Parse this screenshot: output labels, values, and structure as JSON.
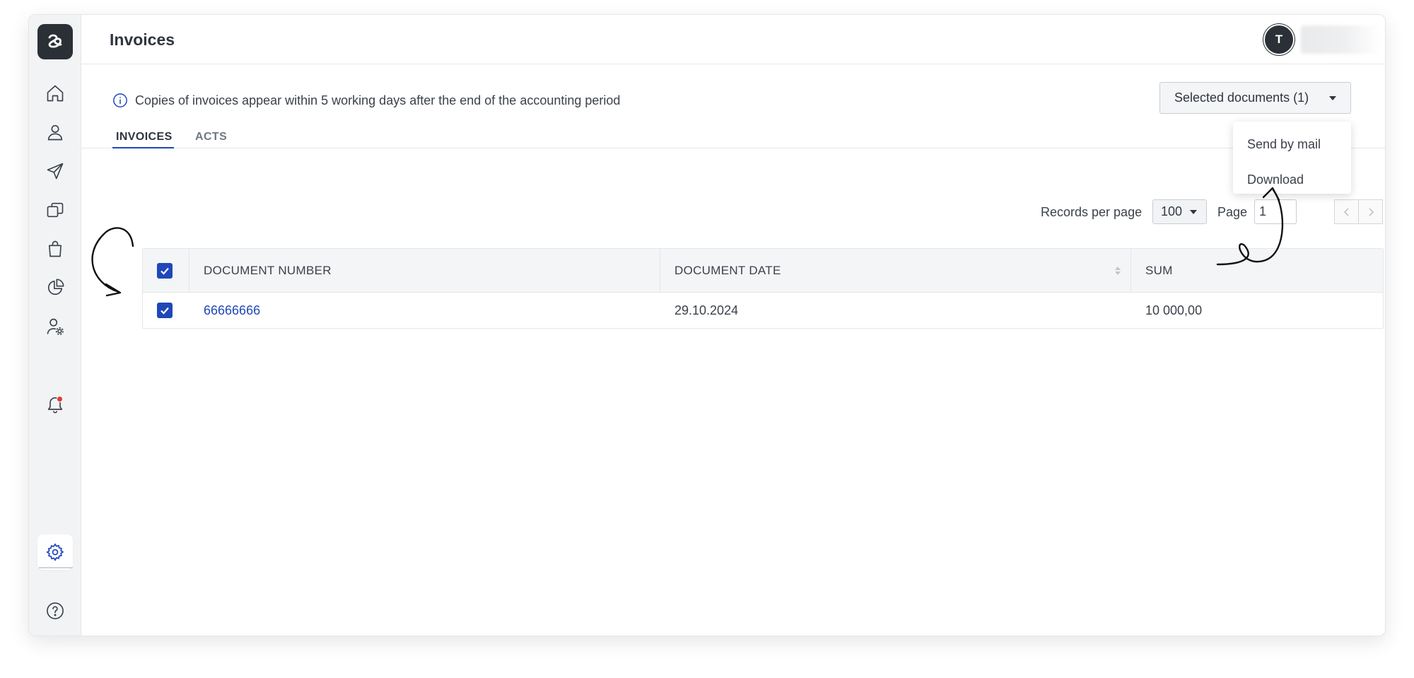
{
  "header": {
    "title": "Invoices",
    "avatar_initial": "T"
  },
  "sidebar": {
    "items": [
      {
        "name": "home",
        "icon": "home-icon"
      },
      {
        "name": "profile",
        "icon": "user-icon"
      },
      {
        "name": "send",
        "icon": "send-icon"
      },
      {
        "name": "documents",
        "icon": "copy-icon"
      },
      {
        "name": "shop",
        "icon": "shopping-bag-icon"
      },
      {
        "name": "reports",
        "icon": "pie-chart-icon"
      },
      {
        "name": "user-settings",
        "icon": "user-settings-icon"
      }
    ],
    "bottom": [
      {
        "name": "notifications",
        "icon": "bell-icon"
      },
      {
        "name": "settings",
        "icon": "gear-icon",
        "active": true
      },
      {
        "name": "help",
        "icon": "help-icon"
      }
    ]
  },
  "info": {
    "text": "Copies of invoices appear within 5 working days after the end of the accounting period"
  },
  "selected_button": {
    "label": "Selected documents (1)"
  },
  "dropdown": {
    "items": [
      "Send by mail",
      "Download"
    ]
  },
  "tabs": [
    {
      "label": "INVOICES",
      "active": true
    },
    {
      "label": "ACTS",
      "active": false
    }
  ],
  "pager": {
    "records_label": "Records per page",
    "records_value": "100",
    "page_label": "Page",
    "page_value": "1"
  },
  "table": {
    "columns": [
      "DOCUMENT NUMBER",
      "DOCUMENT DATE",
      "SUM"
    ],
    "rows": [
      {
        "number": "66666666",
        "date": "29.10.2024",
        "sum": "10 000,00",
        "checked": true
      }
    ],
    "select_all_checked": true
  },
  "colors": {
    "accent": "#1f47b8",
    "sidebar_bg": "#f2f3f5",
    "logo_bg": "#2b2f36",
    "notification": "#e53935"
  }
}
